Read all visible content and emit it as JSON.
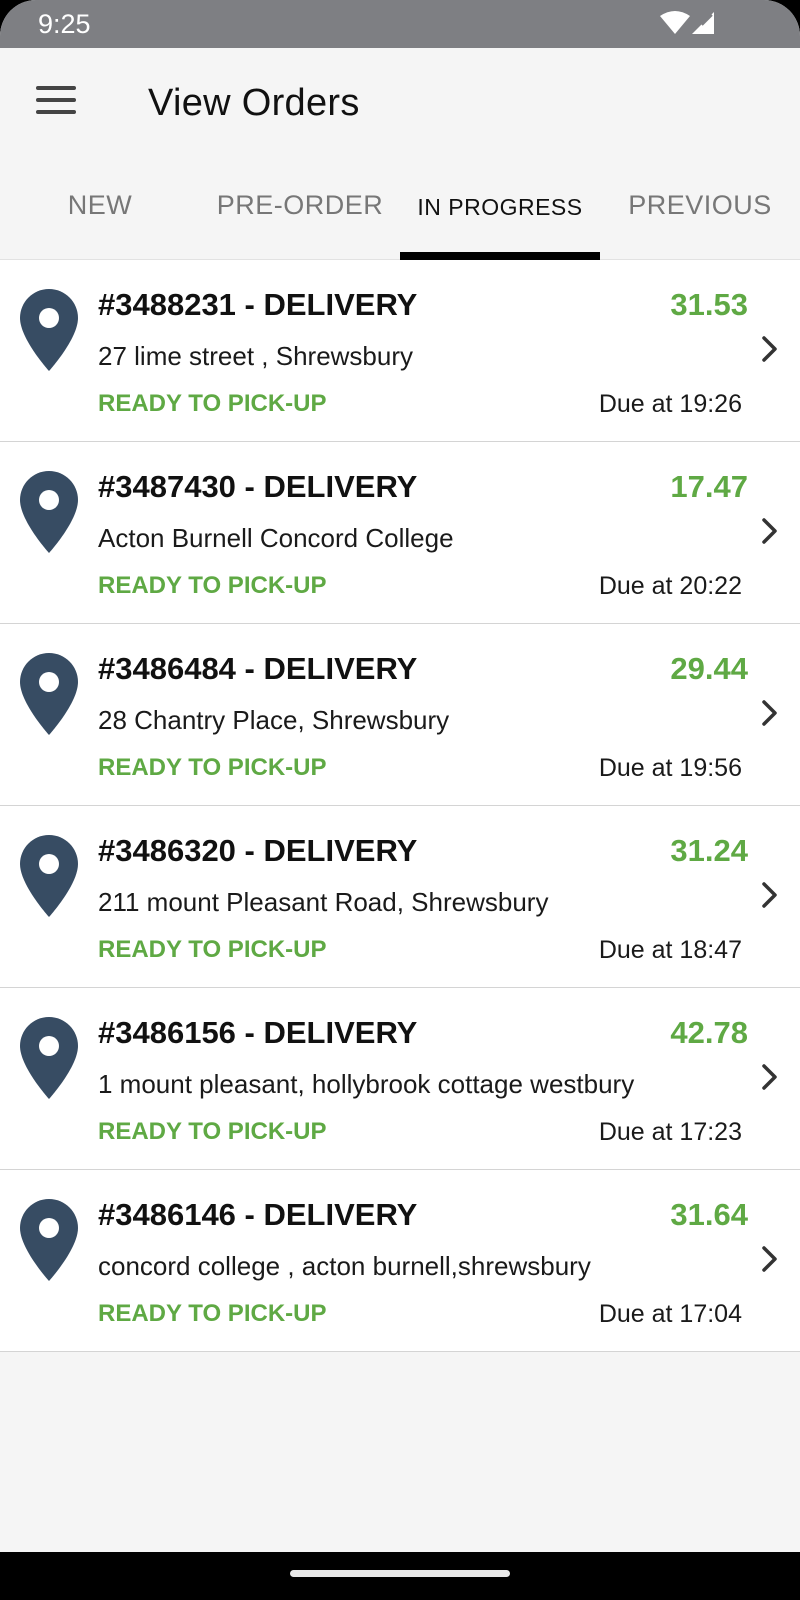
{
  "status_bar": {
    "time": "9:25",
    "icons": [
      "wifi-icon",
      "signal-icon"
    ]
  },
  "header": {
    "title": "View Orders",
    "menu_icon": "menu-icon"
  },
  "tabs": [
    {
      "label": "NEW",
      "active": false
    },
    {
      "label": "PRE-ORDER",
      "active": false
    },
    {
      "label": "IN PROGRESS",
      "active": true
    },
    {
      "label": "PREVIOUS",
      "active": false
    }
  ],
  "colors": {
    "accent_green": "#5fa944",
    "pin": "#374c63",
    "tab_indicator": "#000000"
  },
  "orders": [
    {
      "id": "#3488231 - DELIVERY",
      "amount": "31.53",
      "address": "27 lime street , Shrewsbury",
      "status": "READY TO PICK-UP",
      "due": "Due at 19:26"
    },
    {
      "id": "#3487430 - DELIVERY",
      "amount": "17.47",
      "address": "Acton Burnell Concord College",
      "status": "READY TO PICK-UP",
      "due": "Due at 20:22"
    },
    {
      "id": "#3486484 - DELIVERY",
      "amount": "29.44",
      "address": "28 Chantry Place, Shrewsbury",
      "status": "READY TO PICK-UP",
      "due": "Due at 19:56"
    },
    {
      "id": "#3486320 - DELIVERY",
      "amount": "31.24",
      "address": "211 mount Pleasant Road, Shrewsbury",
      "status": "READY TO PICK-UP",
      "due": "Due at 18:47"
    },
    {
      "id": "#3486156 - DELIVERY",
      "amount": "42.78",
      "address": "1 mount pleasant, hollybrook cottage westbury",
      "status": "READY TO PICK-UP",
      "due": "Due at 17:23"
    },
    {
      "id": "#3486146 - DELIVERY",
      "amount": "31.64",
      "address": "concord college , acton burnell,shrewsbury",
      "status": "READY TO PICK-UP",
      "due": "Due at 17:04"
    }
  ]
}
